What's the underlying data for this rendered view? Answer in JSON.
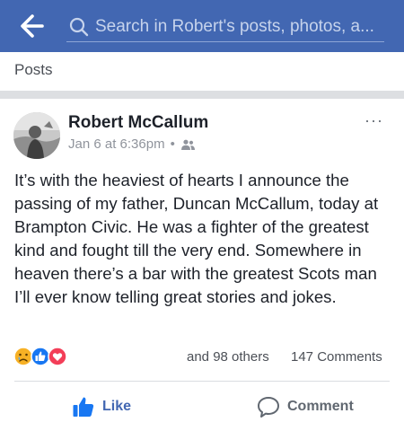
{
  "header": {
    "back_icon": "arrow-left-icon",
    "search_icon": "search-icon",
    "search_placeholder": "Search in Robert's posts, photos, a..."
  },
  "section": {
    "title": "Posts"
  },
  "post": {
    "author": "Robert McCallum",
    "timestamp": "Jan 6 at 6:36pm",
    "separator": "•",
    "audience_icon": "friends-icon",
    "more_icon": "more-options-icon",
    "more_label": "···",
    "text": "It’s with the heaviest of hearts I announce the passing of my father, Duncan McCallum, today at Brampton Civic. He was a fighter of the greatest kind and fought till the very end. Somewhere in heaven there’s a bar with the greatest Scots man I’ll ever know telling great stories and jokes.",
    "reactions": [
      "sad",
      "like",
      "love"
    ],
    "reactions_summary": "and 98 others",
    "comments_count": "147 Comments"
  },
  "actions": {
    "like_label": "Like",
    "comment_label": "Comment"
  },
  "colors": {
    "brand": "#4267b2",
    "like_blue": "#1877f2",
    "love_red": "#f33e58",
    "sad_yellow": "#f7b125"
  }
}
